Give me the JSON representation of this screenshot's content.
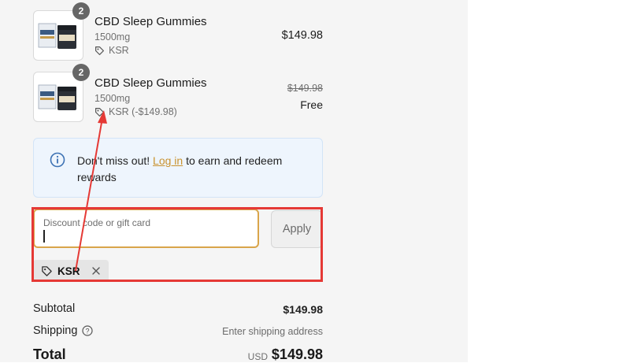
{
  "items": [
    {
      "title": "CBD Sleep Gummies",
      "variant": "1500mg",
      "discount": "KSR",
      "qty": "2",
      "price": "$149.98"
    },
    {
      "title": "CBD Sleep Gummies",
      "variant": "1500mg",
      "discount": "KSR (-$149.98)",
      "qty": "2",
      "original_price": "$149.98",
      "price": "Free"
    }
  ],
  "info": {
    "prefix": "Don't miss out! ",
    "link": "Log in",
    "suffix": " to earn and redeem rewards"
  },
  "discount": {
    "placeholder": "Discount code or gift card",
    "value": "",
    "apply_label": "Apply",
    "applied_code": "KSR"
  },
  "summary": {
    "subtotal_label": "Subtotal",
    "subtotal_value": "$149.98",
    "shipping_label": "Shipping",
    "shipping_value": "Enter shipping address",
    "total_label": "Total",
    "currency": "USD",
    "total_value": "$149.98"
  },
  "colors": {
    "link": "#c9922f",
    "highlight": "#e53935",
    "info_bg": "#eef5fd",
    "focus": "#d9a54a"
  },
  "icons": [
    "product-thumbnail",
    "tag-icon",
    "info-icon",
    "close-icon",
    "help-icon"
  ]
}
